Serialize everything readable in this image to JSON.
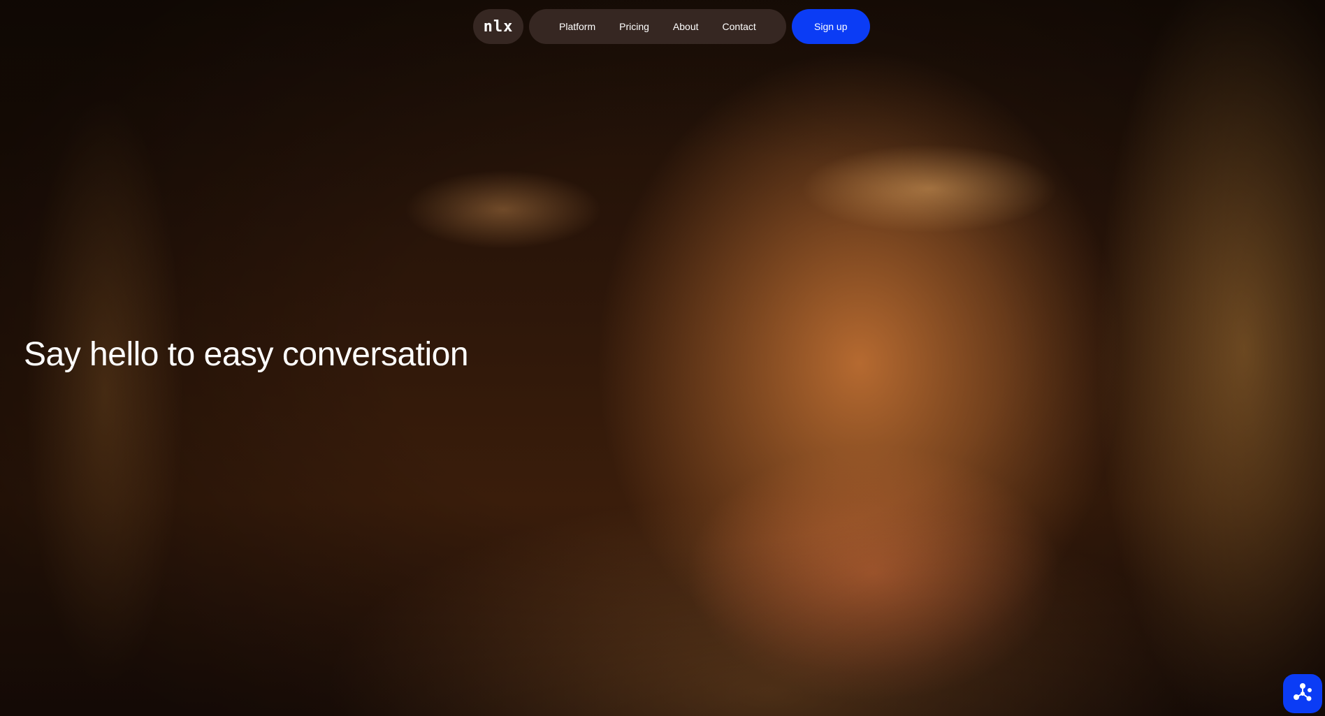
{
  "nav": {
    "logo_text": "nlx",
    "links": [
      "Platform",
      "Pricing",
      "About",
      "Contact"
    ],
    "signup_label": "Sign up"
  },
  "hero": {
    "headline": "Say hello to easy conversation",
    "background_image": "close-up of woman's face in helmet, warm amber light"
  },
  "chat_widget": {
    "icon": "network-nodes-icon"
  },
  "colors": {
    "accent": "#0b3cf5",
    "nav_pill_bg": "#3c2d28"
  }
}
